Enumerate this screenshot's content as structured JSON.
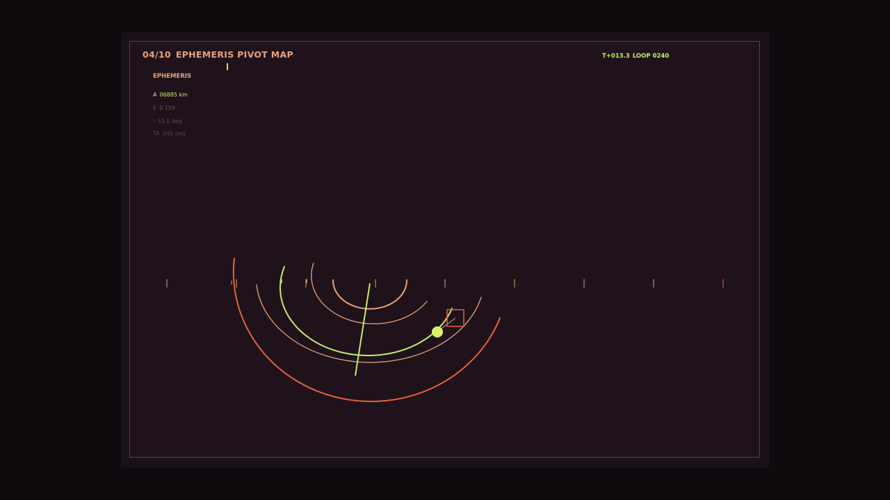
{
  "header": {
    "index": "04/10",
    "title": "EPHEMERIS PIVOT MAP"
  },
  "status": {
    "time": "T+013.3",
    "loop": "LOOP 0240"
  },
  "ephemeris": {
    "label": "EPHEMERIS",
    "items": [
      {
        "key": "A",
        "value": "06885 km",
        "color": "#c8ec6c"
      },
      {
        "key": "E",
        "value": "0.159",
        "color": "#6e5463"
      },
      {
        "key": "I",
        "value": "53.1 deg",
        "color": "#5e4655"
      },
      {
        "key": "TA",
        "value": "048 deg",
        "color": "#553d4c"
      }
    ]
  },
  "colors": {
    "accent_green": "#c8ec6c",
    "accent_orange": "#e8613e",
    "accent_peach": "#e7a37a",
    "frame": "#5e3e50",
    "background": "#1f121b"
  }
}
